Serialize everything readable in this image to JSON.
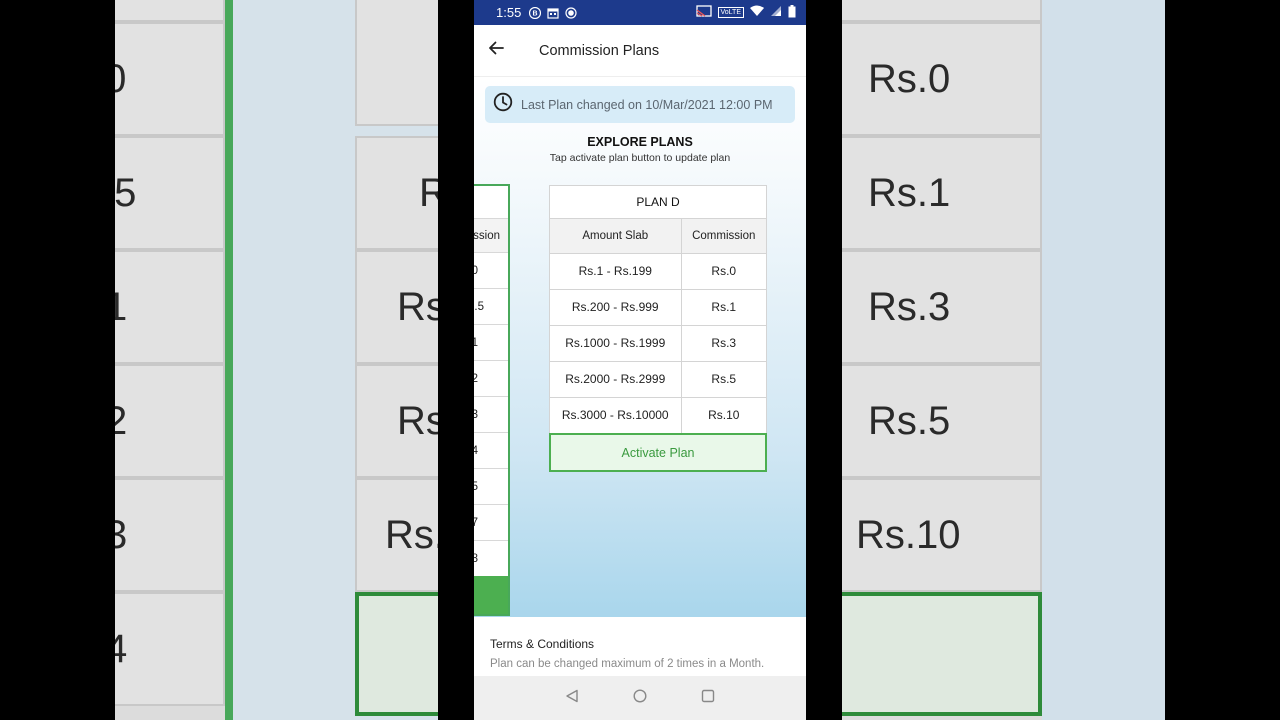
{
  "status_bar": {
    "time": "1:55",
    "network_label": "VoLTE",
    "icons": [
      "b-icon",
      "calendar-icon",
      "record-icon",
      "cast-icon",
      "volte-icon",
      "wifi-icon",
      "signal-icon",
      "battery-icon"
    ]
  },
  "app_bar": {
    "title": "Commission Plans",
    "back_icon": "arrow-left-icon"
  },
  "notice": {
    "icon": "clock-icon",
    "text": "Last Plan changed on 10/Mar/2021 12:00 PM"
  },
  "explore": {
    "title": "EXPLORE PLANS",
    "subtitle": "Tap activate plan button to update plan"
  },
  "prev_plan": {
    "header_fragment": "ssion",
    "value_fragments": [
      "0",
      ".5",
      "1",
      "2",
      "3",
      "4",
      "5",
      "7",
      "8"
    ]
  },
  "plan": {
    "name": "PLAN D",
    "columns": [
      "Amount Slab",
      "Commission"
    ],
    "rows": [
      {
        "slab": "Rs.1 - Rs.199",
        "commission": "Rs.0"
      },
      {
        "slab": "Rs.200 - Rs.999",
        "commission": "Rs.1"
      },
      {
        "slab": "Rs.1000 - Rs.1999",
        "commission": "Rs.3"
      },
      {
        "slab": "Rs.2000 - Rs.2999",
        "commission": "Rs.5"
      },
      {
        "slab": "Rs.3000 - Rs.10000",
        "commission": "Rs.10"
      }
    ],
    "button_label": "Activate Plan"
  },
  "terms": {
    "title": "Terms & Conditions",
    "text": "Plan can be changed maximum of 2 times in a Month."
  },
  "background": {
    "left_fragments": [
      ".0",
      ".5",
      "1",
      "2",
      "3",
      "4"
    ],
    "middle_fragments": [
      "Rs",
      "Rs",
      "Rs",
      "Rs."
    ],
    "right_values": [
      "Rs.0",
      "Rs.1",
      "Rs.3",
      "Rs.5",
      "Rs.10"
    ]
  },
  "colors": {
    "status_bar": "#1d3a8c",
    "accent_green": "#4caf50",
    "notice_bg": "#d7ecf8"
  }
}
